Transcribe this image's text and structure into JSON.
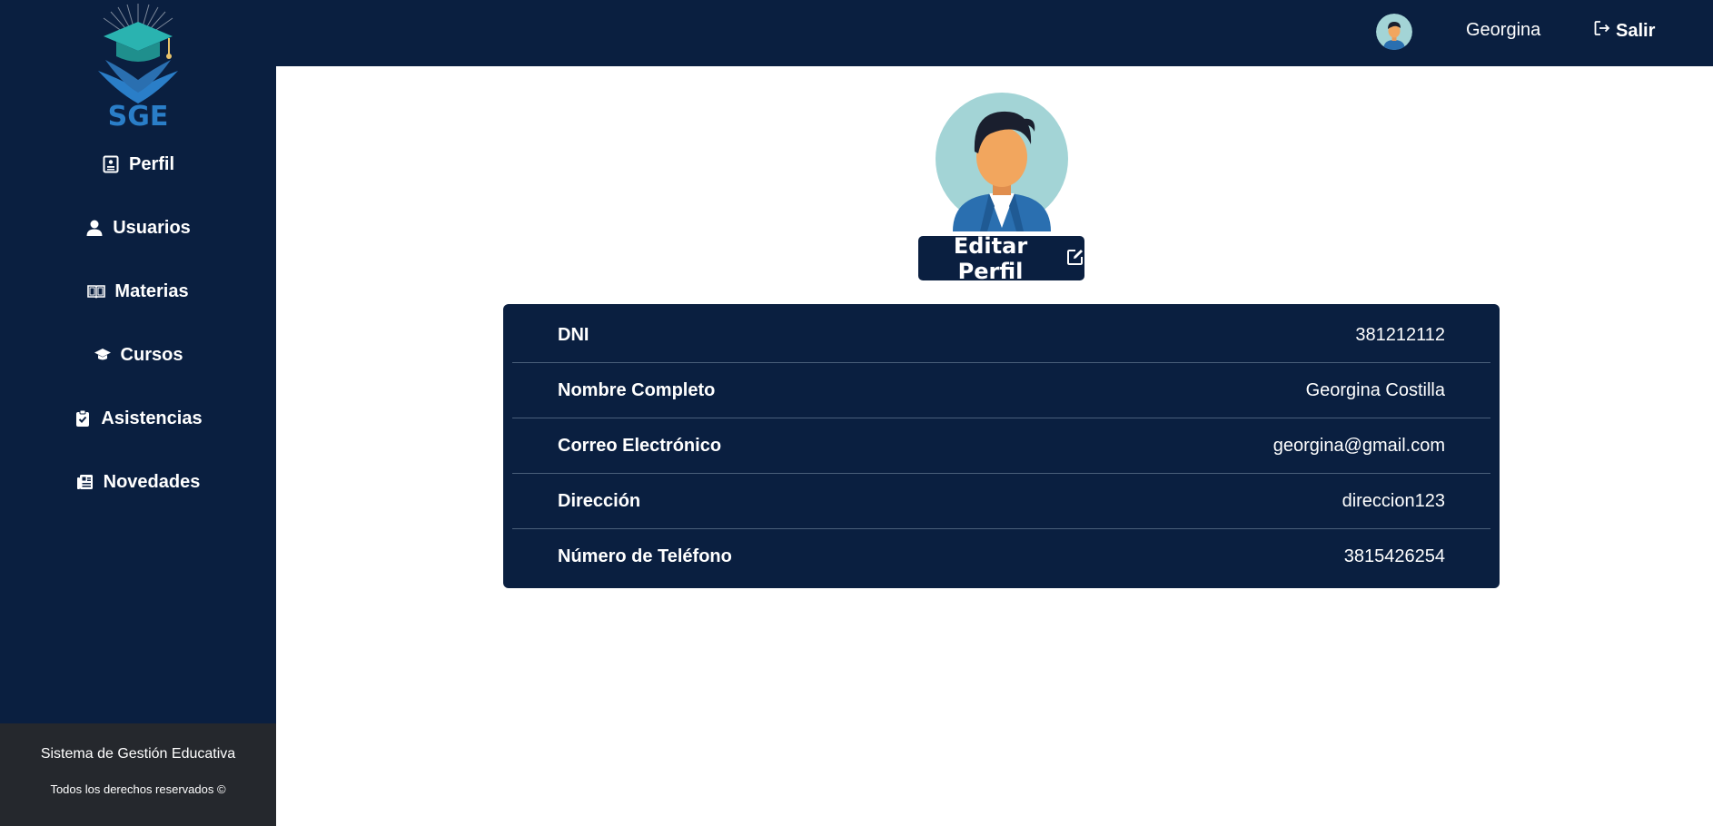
{
  "brand": {
    "logo_text": "SGE",
    "icon": "graduation-cap-icon"
  },
  "sidebar": {
    "items": [
      {
        "label": "Perfil",
        "icon": "id-card-icon"
      },
      {
        "label": "Usuarios",
        "icon": "user-icon"
      },
      {
        "label": "Materias",
        "icon": "book-open-icon"
      },
      {
        "label": "Cursos",
        "icon": "graduation-cap-icon"
      },
      {
        "label": "Asistencias",
        "icon": "clipboard-check-icon"
      },
      {
        "label": "Novedades",
        "icon": "newspaper-icon"
      }
    ],
    "footer": {
      "title": "Sistema de Gestión Educativa",
      "rights": "Todos los derechos reservados ©"
    }
  },
  "topbar": {
    "username": "Georgina",
    "logout_label": "Salir",
    "logout_icon": "logout-icon"
  },
  "profile": {
    "edit_label": "Editar Perfil",
    "edit_icon": "edit-icon",
    "fields": [
      {
        "label": "DNI",
        "value": "381212112"
      },
      {
        "label": "Nombre Completo",
        "value": "Georgina Costilla"
      },
      {
        "label": "Correo Electrónico",
        "value": "georgina@gmail.com"
      },
      {
        "label": "Dirección",
        "value": "direccion123"
      },
      {
        "label": "Número de Teléfono",
        "value": "3815426254"
      }
    ]
  },
  "colors": {
    "navy": "#0a1f40",
    "footer": "#25282d",
    "logo_teal": "#2ab3b0",
    "logo_blue": "#2a7ec8"
  }
}
